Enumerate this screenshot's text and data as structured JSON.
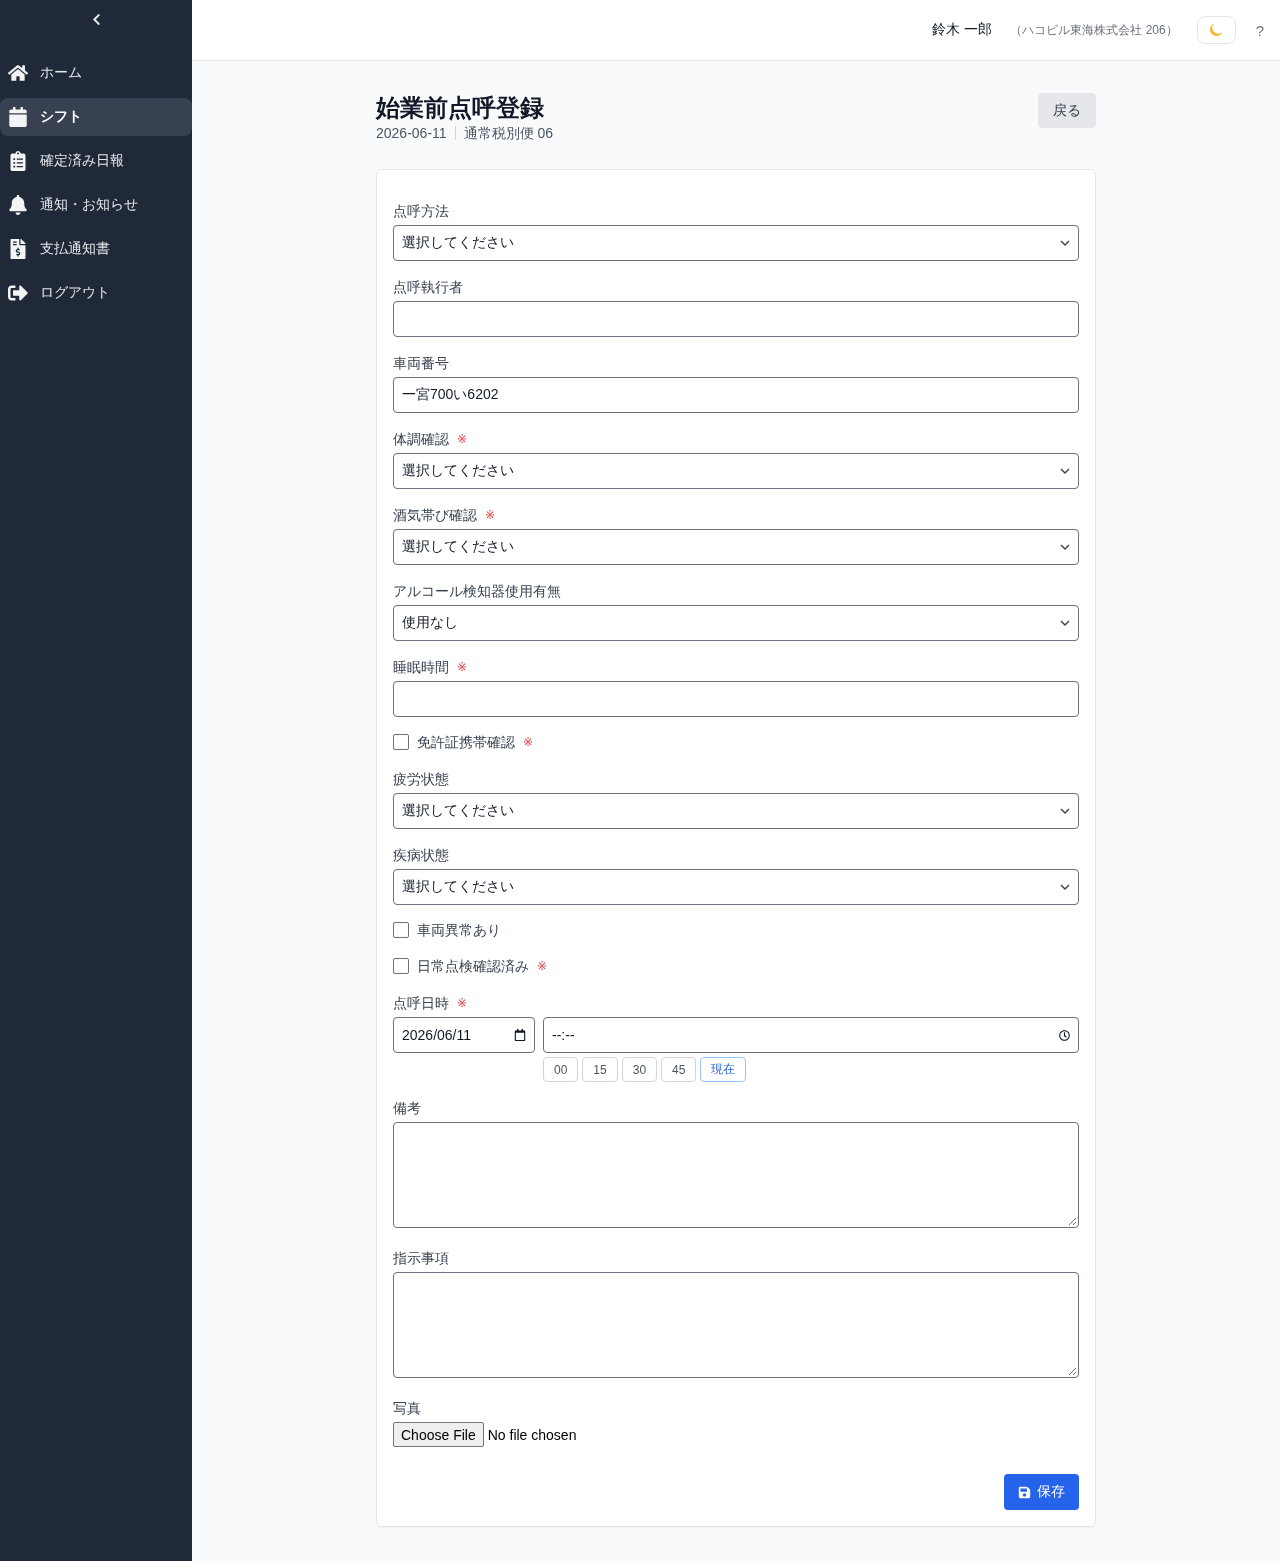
{
  "sidebar": {
    "items": [
      {
        "kind": "home",
        "label": "ホーム",
        "selected": false
      },
      {
        "kind": "calendar",
        "label": "シフト",
        "selected": true
      },
      {
        "kind": "clipboard",
        "label": "確定済み日報",
        "selected": false
      },
      {
        "kind": "bell",
        "label": "通知・お知らせ",
        "selected": false
      },
      {
        "kind": "invoice",
        "label": "支払通知書",
        "selected": false
      },
      {
        "kind": "logout",
        "label": "ログアウト",
        "selected": false
      }
    ]
  },
  "header": {
    "user_name": "鈴木 一郎",
    "company": "（ハコビル東海株式会社 206）",
    "help": "?"
  },
  "page": {
    "title": "始業前点呼登録",
    "date": "2026-06-11",
    "route": "通常税別便 06",
    "back_button": "戻る"
  },
  "form": {
    "required_mark": "※",
    "fields": [
      {
        "kind": "select",
        "label": "点呼方法",
        "required": false,
        "value": "選択してください"
      },
      {
        "kind": "text",
        "label": "点呼執行者",
        "required": false
      },
      {
        "kind": "text",
        "label": "車両番号",
        "required": false,
        "value": "一宮700い6202"
      },
      {
        "kind": "select",
        "label": "体調確認",
        "required": true,
        "value": "選択してください"
      },
      {
        "kind": "select",
        "label": "酒気帯び確認",
        "required": true,
        "value": "選択してください"
      },
      {
        "kind": "select",
        "label": "アルコール検知器使用有無",
        "required": false,
        "value": "使用なし"
      },
      {
        "kind": "text",
        "label": "睡眠時間",
        "required": true
      },
      {
        "kind": "checkbox",
        "label": "免許証携帯確認",
        "required": true,
        "checked": false
      },
      {
        "kind": "select",
        "label": "疲労状態",
        "required": false,
        "value": "選択してください"
      },
      {
        "kind": "select",
        "label": "疾病状態",
        "required": false,
        "value": "選択してください"
      },
      {
        "kind": "checkbox",
        "label": "車両異常あり",
        "required": false,
        "checked": false
      },
      {
        "kind": "checkbox",
        "label": "日常点検確認済み",
        "required": true,
        "checked": false
      },
      {
        "kind": "datetime",
        "label": "点呼日時",
        "required": true,
        "date": "2026/06/11",
        "time": {
          "placeholder": "--:--"
        },
        "quick_buttons": [
          {
            "kind": "minute",
            "label": "00"
          },
          {
            "kind": "minute",
            "label": "15"
          },
          {
            "kind": "minute",
            "label": "30"
          },
          {
            "kind": "minute",
            "label": "45"
          },
          {
            "kind": "now",
            "label": "現在"
          }
        ]
      },
      {
        "kind": "textarea",
        "label": "備考",
        "required": false
      },
      {
        "kind": "textarea",
        "label": "指示事項",
        "required": false
      },
      {
        "kind": "file",
        "label": "写真",
        "required": false,
        "button": "Choose File",
        "status": "No file chosen"
      }
    ],
    "save_button": "保存"
  }
}
